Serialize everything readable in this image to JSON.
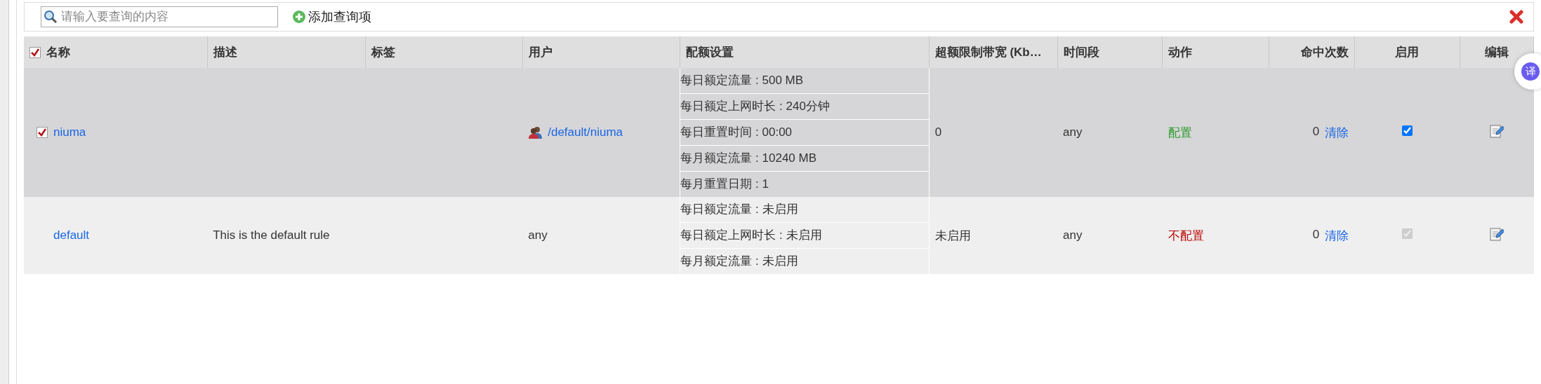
{
  "toolbar": {
    "search": {
      "placeholder": "请输入要查询的内容"
    },
    "add_button": "添加查询项"
  },
  "table": {
    "columns": [
      {
        "label": "名称",
        "checked": true
      },
      {
        "label": "描述"
      },
      {
        "label": "标签"
      },
      {
        "label": "用户"
      },
      {
        "label": "配额设置"
      },
      {
        "label": "超额限制带宽 (Kb…"
      },
      {
        "label": "时间段"
      },
      {
        "label": "动作"
      },
      {
        "label": "命中次数"
      },
      {
        "label": "启用"
      },
      {
        "label": "编辑"
      }
    ],
    "rows": [
      {
        "checked": true,
        "name": "niuma",
        "description": "",
        "tags": "",
        "user": {
          "text": "/default/niuma",
          "kind": "link"
        },
        "quota": [
          "每日额定流量 : 500 MB",
          "每日额定上网时长 : 240分钟",
          "每日重置时间 : 00:00",
          "每月额定流量 : 10240 MB",
          "每月重置日期 : 1"
        ],
        "excess": "0",
        "time": "any",
        "action": {
          "text": "配置",
          "color": "#2a9a2a"
        },
        "hits": "0",
        "clear": "清除",
        "enabled": true,
        "disabled": false
      },
      {
        "name": "default",
        "description": "This is the default rule",
        "tags": "",
        "user": {
          "text": "any",
          "kind": "plain"
        },
        "quota": [
          "每日额定流量 : 未启用",
          "每日额定上网时长 : 未启用",
          "每月额定流量 : 未启用"
        ],
        "excess": "未启用",
        "time": "any",
        "action": {
          "text": "不配置",
          "color": "#bb0000"
        },
        "hits": "0",
        "clear": "清除",
        "enabled": true,
        "disabled": true
      }
    ]
  },
  "floating_button": "译"
}
